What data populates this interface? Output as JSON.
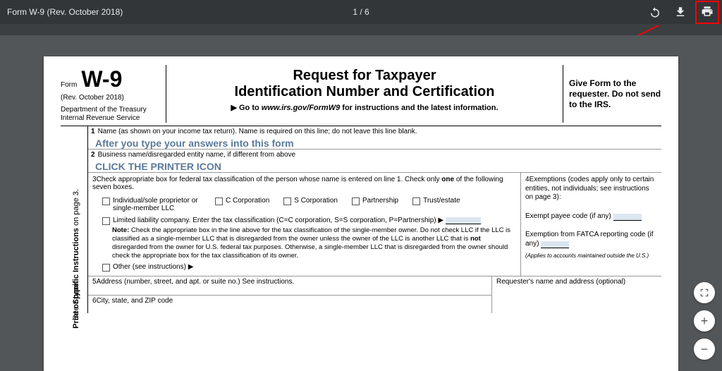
{
  "toolbar": {
    "title": "Form W-9 (Rev. October 2018)",
    "page_indicator": "1 / 6"
  },
  "header": {
    "form_word": "Form",
    "form_number": "W-9",
    "revision": "(Rev. October 2018)",
    "dept1": "Department of the Treasury",
    "dept2": "Internal Revenue Service",
    "title_line1": "Request for Taxpayer",
    "title_line2": "Identification Number and Certification",
    "goto_prefix": "▶ Go to ",
    "goto_url": "www.irs.gov/FormW9",
    "goto_suffix": " for instructions and the latest information.",
    "right_box": "Give Form to the requester. Do not send to the IRS."
  },
  "side": {
    "print_type": "Print or type.",
    "see_instr": "See Specific Instructions on page 3."
  },
  "lines": {
    "l1_label": "1",
    "l1_text": "Name (as shown on your income tax return). Name is required on this line; do not leave this line blank.",
    "l1_entry": "After you type your answers into this form",
    "l2_label": "2",
    "l2_text": "Business name/disregarded entity name, if different from above",
    "l2_entry": "CLICK THE PRINTER ICON",
    "l3_label": "3",
    "l3_text_a": "Check appropriate box for federal tax classification of the person whose name is entered on line 1. Check only ",
    "l3_text_b": "one",
    "l3_text_c": " of the following seven boxes.",
    "l4_label": "4",
    "l4_text": "Exemptions (codes apply only to certain entities, not individuals; see instructions on page 3):",
    "exempt_payee": "Exempt payee code (if any)",
    "fatca_label": "Exemption from FATCA reporting code (if any)",
    "applies_note": "(Applies to accounts maintained outside the U.S.)",
    "l5_label": "5",
    "l5_text": "Address (number, street, and apt. or suite no.) See instructions.",
    "requester": "Requester's name and address (optional)",
    "l6_label": "6",
    "l6_text": "City, state, and ZIP code"
  },
  "checkboxes": {
    "individual": "Individual/sole proprietor or single-member LLC",
    "ccorp": "C Corporation",
    "scorp": "S Corporation",
    "partnership": "Partnership",
    "trust": "Trust/estate",
    "llc": "Limited liability company. Enter the tax classification (C=C corporation, S=S corporation, P=Partnership) ▶",
    "other": "Other (see instructions) ▶"
  },
  "note": {
    "prefix": "Note: ",
    "body_a": "Check the appropriate box in the line above for the tax classification of the single-member owner.  Do not check LLC if the LLC is classified as a single-member LLC that is disregarded from the owner unless the owner of the LLC is another LLC that is ",
    "body_b": "not",
    "body_c": " disregarded from the owner for U.S. federal tax purposes. Otherwise, a single-member LLC that is disregarded from the owner should check the appropriate box for the tax classification of its owner."
  }
}
